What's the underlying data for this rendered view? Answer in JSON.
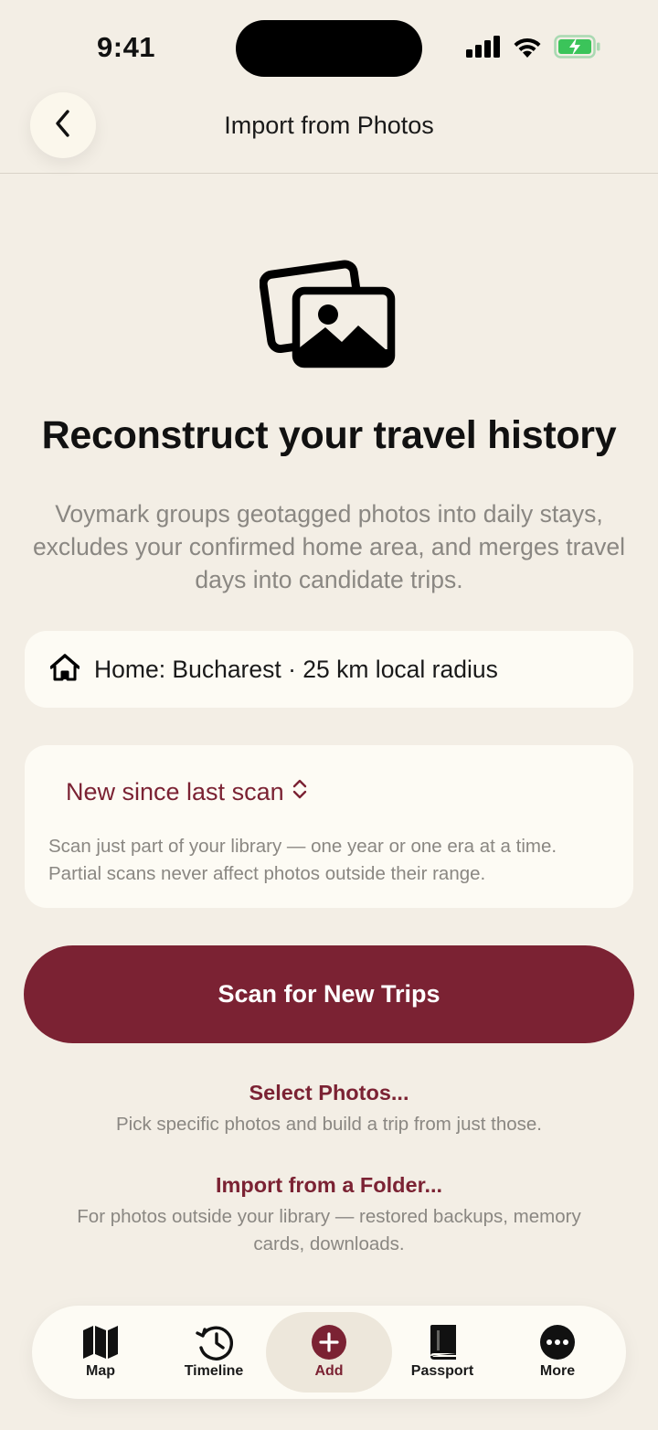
{
  "status": {
    "time": "9:41",
    "icons": [
      "cellular-signal-icon",
      "wifi-icon",
      "battery-charging-icon"
    ]
  },
  "header": {
    "title": "Import from Photos",
    "back_icon": "chevron-left-icon"
  },
  "hero": {
    "icon": "photos-stack-icon",
    "title": "Reconstruct your travel history",
    "description": "Voymark groups geotagged photos into daily stays, excludes your confirmed home area, and merges travel days into candidate trips."
  },
  "home": {
    "icon": "house-icon",
    "text": "Home: Bucharest · 25 km local radius"
  },
  "scope": {
    "selected": "New since last scan",
    "icon": "chevron-up-down-icon",
    "note_line1": "Scan just part of your library — one year or one era at a time.",
    "note_line2": "Partial scans never affect photos outside their range."
  },
  "primary_action": {
    "label": "Scan for New Trips"
  },
  "options": {
    "select_photos": {
      "title": "Select Photos...",
      "description": "Pick specific photos and build a trip from just those."
    },
    "import_folder": {
      "title": "Import from a Folder...",
      "description_line1": "For photos outside your library — restored backups, memory",
      "description_line2": "cards, downloads."
    }
  },
  "tabs": [
    {
      "label": "Map",
      "icon": "map-icon"
    },
    {
      "label": "Timeline",
      "icon": "history-clock-icon"
    },
    {
      "label": "Add",
      "icon": "plus-circle-icon",
      "active": true
    },
    {
      "label": "Passport",
      "icon": "book-icon"
    },
    {
      "label": "More",
      "icon": "ellipsis-circle-icon"
    }
  ],
  "colors": {
    "background": "#F3EEE5",
    "card": "#FDFBF4",
    "accent": "#7B2233",
    "muted_text": "#8a8782",
    "battery": "#3BC45A"
  }
}
